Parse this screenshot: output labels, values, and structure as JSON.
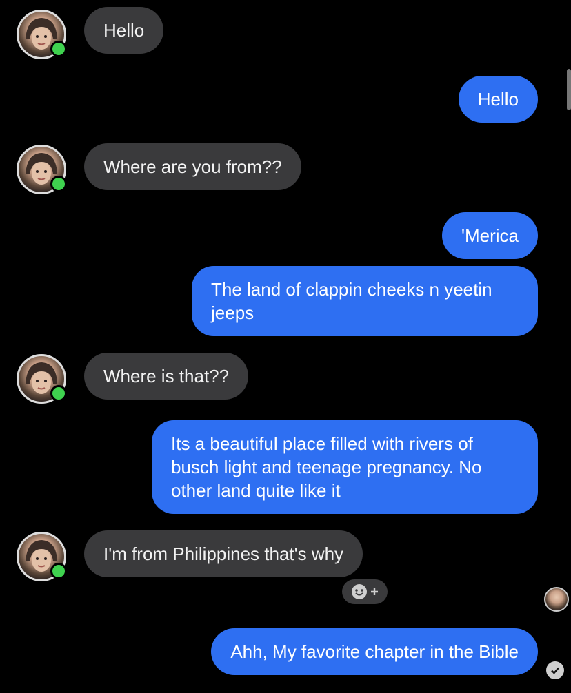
{
  "messages": [
    {
      "from": "them",
      "text": "Hello"
    },
    {
      "from": "me",
      "text": "Hello"
    },
    {
      "from": "them",
      "text": "Where are you from??"
    },
    {
      "from": "me",
      "text": "'Merica"
    },
    {
      "from": "me",
      "text": "The land of clappin cheeks n yeetin jeeps"
    },
    {
      "from": "them",
      "text": "Where is that??"
    },
    {
      "from": "me",
      "text": "Its a beautiful place filled with rivers of busch light and teenage pregnancy. No other land quite like it"
    },
    {
      "from": "them",
      "text": "I'm from Philippines that's why"
    },
    {
      "from": "me",
      "text": "Ahh, My favorite chapter in the Bible"
    }
  ],
  "icons": {
    "contact_avatar": "avatar-photo",
    "online_indicator": "online-dot",
    "add_reaction": "smiley-plus-icon",
    "read_receipt_avatar": "avatar-photo",
    "sent_status": "checkmark-icon"
  },
  "colors": {
    "background": "#000000",
    "incoming_bubble": "#3a3a3c",
    "outgoing_bubble": "#2e6ff2",
    "online": "#3fd24f"
  }
}
